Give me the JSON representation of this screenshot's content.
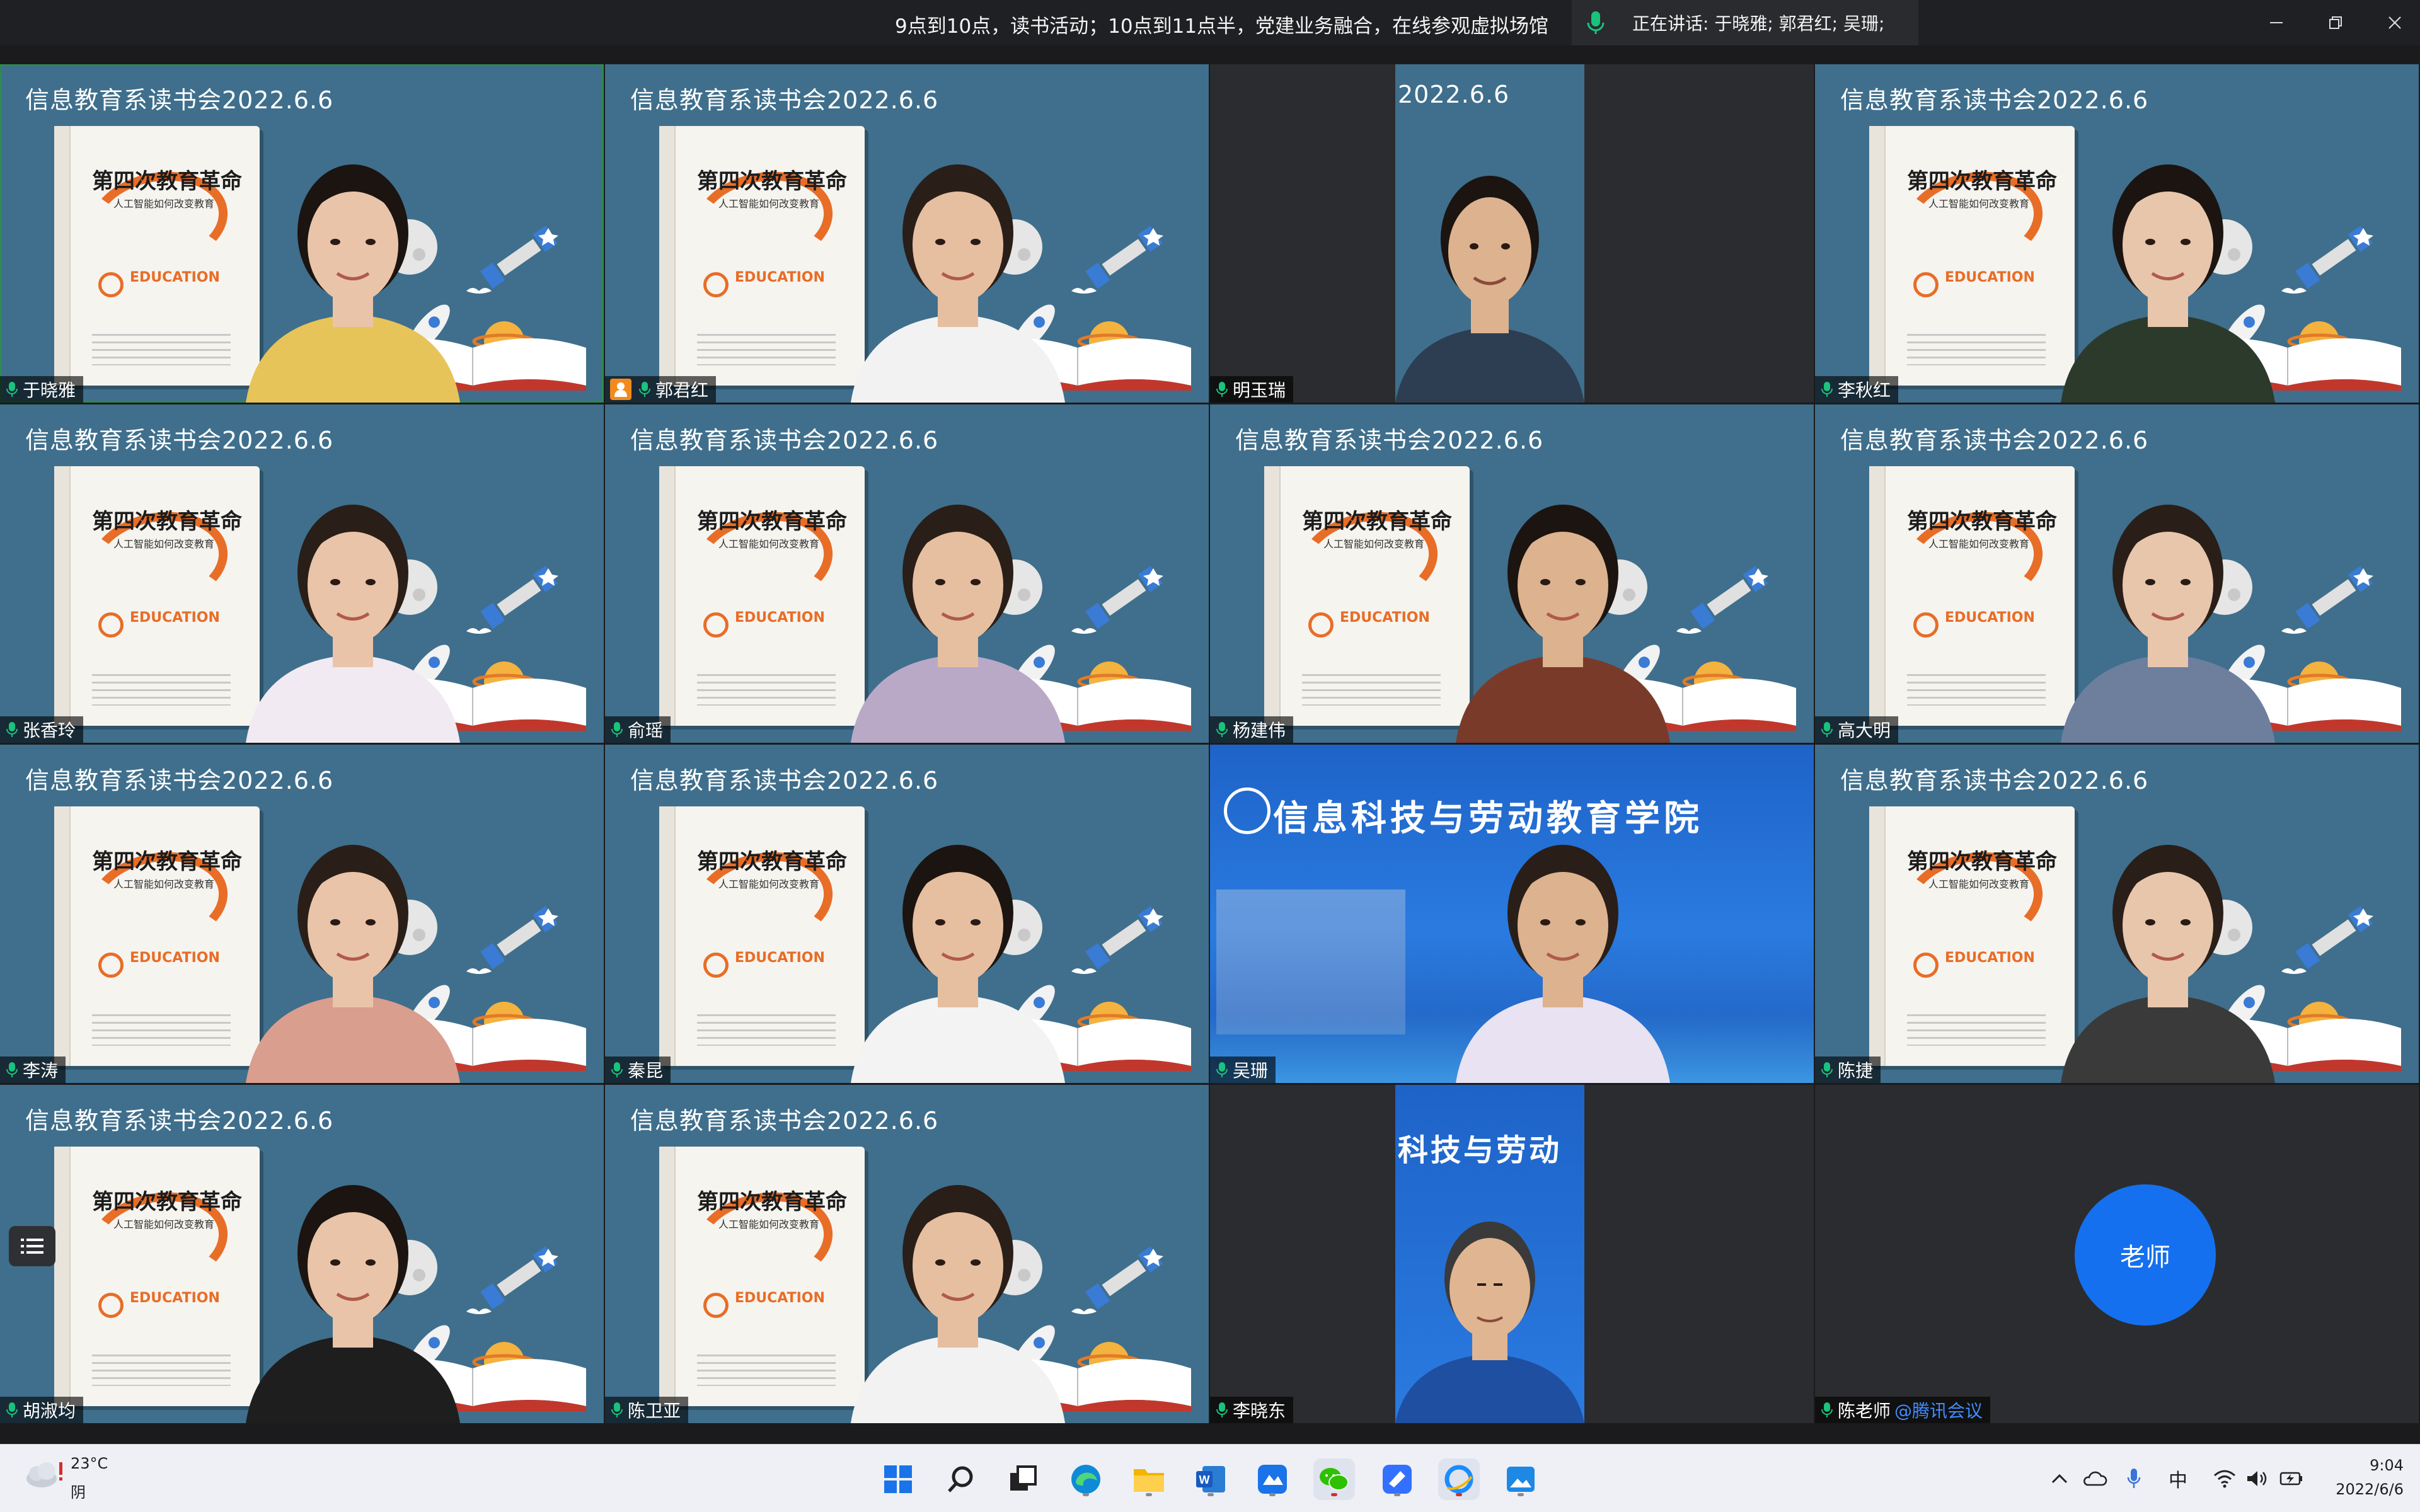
{
  "titlebar": {
    "topic": "9点到10点，读书活动；10点到11点半，党建业务融合，在线参观虚拟场馆",
    "speaking": "正在讲话: 于晓雅; 郭君红; 吴珊;"
  },
  "slide": {
    "caption": "信息教育系读书会2022.6.6",
    "caption_cut": "2022.6.6",
    "book_title": "第四次教育革命",
    "book_subtitle": "人工智能如何改变教育",
    "book_edu": "EDUCATION",
    "school_name": "信息科技与劳动教育学院",
    "school_name_cut": "科技与劳动"
  },
  "participants": [
    {
      "name": "于晓雅"
    },
    {
      "name": "郭君红"
    },
    {
      "name": "明玉瑞"
    },
    {
      "name": "李秋红"
    },
    {
      "name": "张香玲"
    },
    {
      "name": "俞瑶"
    },
    {
      "name": "杨建伟"
    },
    {
      "name": "高大明"
    },
    {
      "name": "李涛"
    },
    {
      "name": "秦昆"
    },
    {
      "name": "吴珊"
    },
    {
      "name": "陈捷"
    },
    {
      "name": "胡淑均"
    },
    {
      "name": "陈卫亚"
    },
    {
      "name": "李晓东"
    },
    {
      "name": "陈老师",
      "suffix": "@腾讯会议",
      "avatar": "老师"
    }
  ],
  "taskbar": {
    "weather_temp": "23°C",
    "weather_cond": "阴",
    "ime": "中",
    "time": "9:04",
    "date": "2022/6/6",
    "apps": [
      "windows-start",
      "search",
      "task-view",
      "edge",
      "file-explorer",
      "word",
      "tencent-meeting",
      "wechat",
      "feishu",
      "qq-browser",
      "photos"
    ]
  },
  "colors": {
    "slide_bg": "#3f6f8c",
    "accent_orange": "#e86d27",
    "avatar_blue": "#1570ef",
    "active_border": "#2d8a52"
  }
}
